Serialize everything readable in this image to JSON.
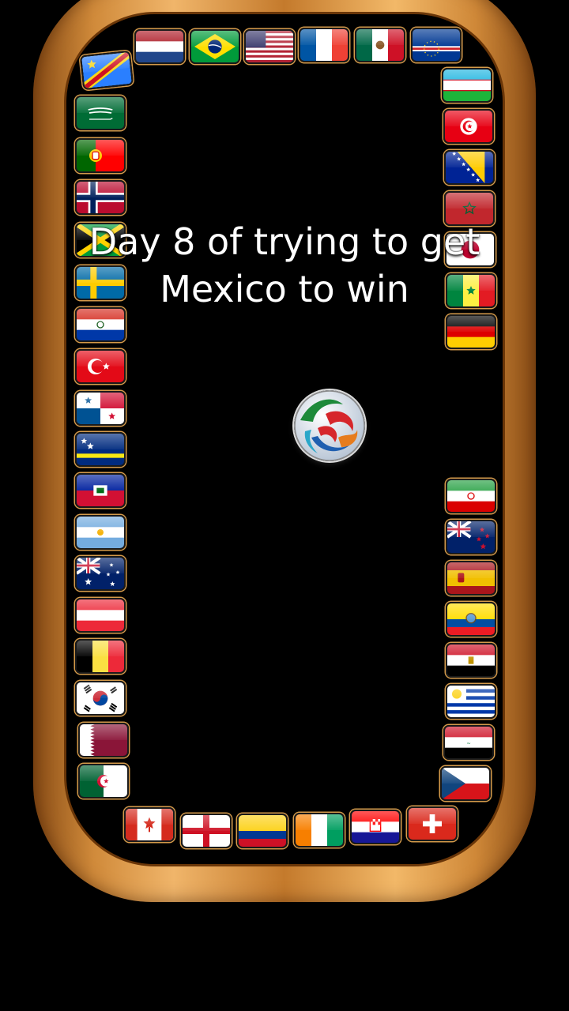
{
  "video": {
    "caption_line1": "Day 8 of trying to get",
    "caption_line2": "Mexico to win"
  },
  "game": {
    "ball_icon": "soccer-ball-icon",
    "frame_color": "#d9963f",
    "flags": [
      "dr-congo",
      "netherlands",
      "brazil",
      "usa",
      "france",
      "mexico",
      "cape-verde",
      "uzbekistan",
      "tunisia",
      "bosnia",
      "morocco",
      "japan",
      "senegal",
      "germany",
      "iran",
      "new-zealand",
      "spain",
      "ecuador",
      "egypt",
      "uruguay",
      "iraq",
      "czech-republic",
      "switzerland",
      "croatia",
      "ivory-coast",
      "colombia",
      "england",
      "canada",
      "algeria",
      "qatar",
      "south-korea",
      "belgium",
      "austria",
      "australia",
      "argentina",
      "haiti",
      "curacao",
      "panama",
      "turkey",
      "paraguay",
      "sweden",
      "jamaica",
      "norway",
      "portugal",
      "saudi-arabia"
    ]
  }
}
